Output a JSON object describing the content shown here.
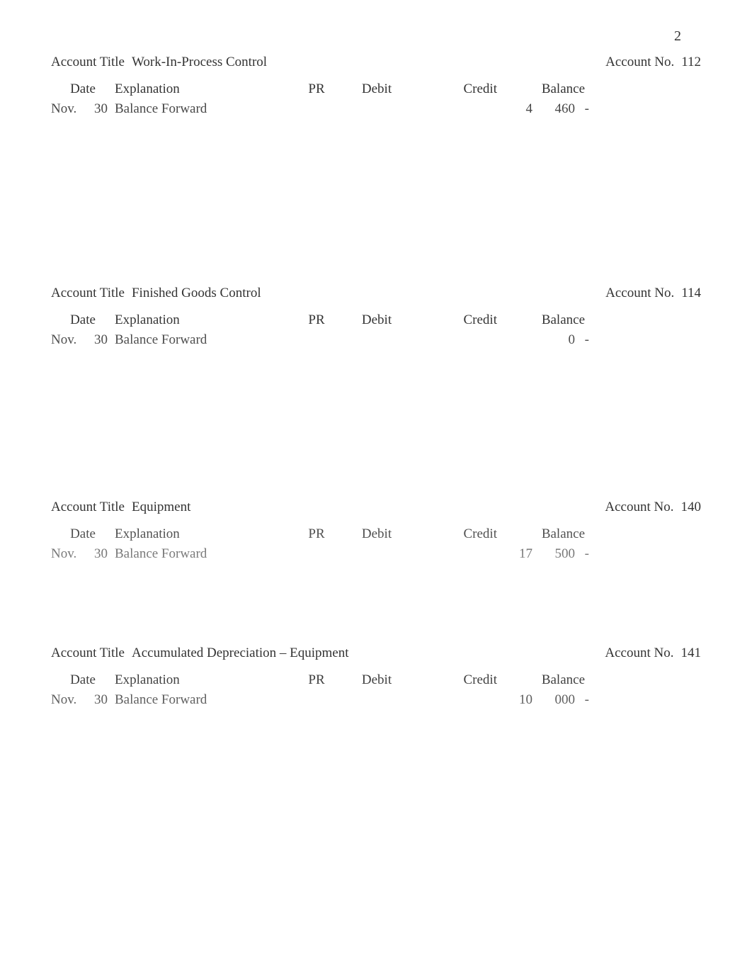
{
  "page_number": "2",
  "labels": {
    "account_title": "Account Title",
    "account_no": "Account No."
  },
  "headers": {
    "date": "Date",
    "explanation": "Explanation",
    "pr": "PR",
    "debit": "Debit",
    "credit": "Credit",
    "balance": "Balance"
  },
  "ledgers": [
    {
      "title": "Work-In-Process Control",
      "number": "112",
      "row": {
        "month": "Nov.",
        "day": "30",
        "explanation": "Balance Forward",
        "bal_th": "4",
        "bal_hund": "460",
        "dash": "-"
      },
      "blank_rows": 8
    },
    {
      "title": "Finished Goods Control",
      "number": "114",
      "row": {
        "month": "Nov.",
        "day": "30",
        "explanation": "Balance Forward",
        "bal_th": "",
        "bal_hund": "0",
        "dash": "-"
      },
      "blank_rows": 7
    },
    {
      "title": "Equipment",
      "number": "140",
      "row": {
        "month": "Nov.",
        "day": "30",
        "explanation": "Balance Forward",
        "bal_th": "17",
        "bal_hund": "500",
        "dash": "-"
      },
      "blank_rows": 3
    },
    {
      "title": "Accumulated Depreciation – Equipment",
      "number": "141",
      "row": {
        "month": "Nov.",
        "day": "30",
        "explanation": "Balance Forward",
        "bal_th": "10",
        "bal_hund": "000",
        "dash": "-"
      },
      "blank_rows": 5
    }
  ]
}
